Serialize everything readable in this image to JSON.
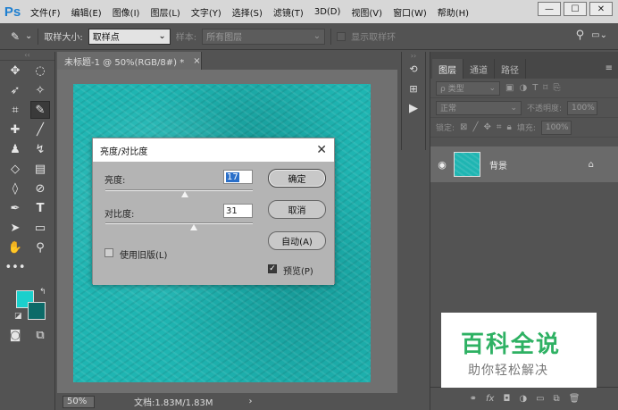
{
  "menubar": {
    "logo": "Ps",
    "items": [
      "文件(F)",
      "编辑(E)",
      "图像(I)",
      "图层(L)",
      "文字(Y)",
      "选择(S)",
      "滤镜(T)",
      "3D(D)",
      "视图(V)",
      "窗口(W)",
      "帮助(H)"
    ],
    "window_controls": [
      "—",
      "☐",
      "✕"
    ]
  },
  "options_bar": {
    "sample_size_label": "取样大小:",
    "sample_size_value": "取样点",
    "sample_label": "样本:",
    "sample_value": "所有图层",
    "show_ring_label": "显示取样环"
  },
  "document": {
    "tab_title": "未标题-1 @ 50%(RGB/8#) *",
    "tab_close": "×",
    "zoom": "50%",
    "doc_info": "文档:1.83M/1.83M",
    "status_arrow": "›"
  },
  "dialog": {
    "title": "亮度/对比度",
    "close": "✕",
    "brightness_label": "亮度:",
    "brightness_value": "17",
    "brightness_fraction": 0.54,
    "contrast_label": "对比度:",
    "contrast_value": "31",
    "contrast_fraction": 0.6,
    "ok_label": "确定",
    "cancel_label": "取消",
    "auto_label": "自动(A)",
    "legacy_label": "使用旧版(L)",
    "legacy_checked": false,
    "preview_label": "预览(P)",
    "preview_checked": true
  },
  "layers_panel": {
    "tabs": [
      "图层",
      "通道",
      "路径"
    ],
    "filter_label": "ρ 类型",
    "blend_mode": "正常",
    "opacity_label": "不透明度:",
    "opacity_value": "100%",
    "lock_label": "锁定:",
    "fill_label": "填充:",
    "fill_value": "100%",
    "layer_name": "背景"
  },
  "watermark": {
    "main": "百科全说",
    "sub": "助你轻松解决"
  },
  "colors": {
    "foreground": "#1ad0cc",
    "background": "#0c6a68",
    "canvas_base": "#1fb5b2"
  }
}
